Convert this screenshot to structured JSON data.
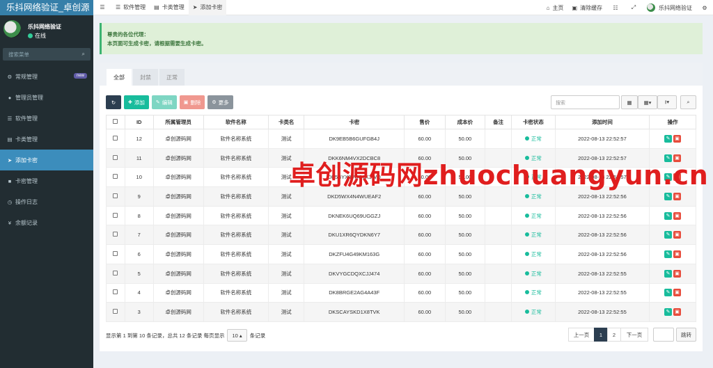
{
  "app": {
    "brand": "乐抖网络验证_卓创源"
  },
  "user": {
    "name": "乐抖网络验证",
    "status": "在线"
  },
  "sidebar": {
    "search_placeholder": "搜索菜单",
    "items": [
      {
        "label": "常规管理",
        "icon": "cogs-icon",
        "badge": "new"
      },
      {
        "label": "管理员管理",
        "icon": "user-icon"
      },
      {
        "label": "软件管理",
        "icon": "list-icon"
      },
      {
        "label": "卡类管理",
        "icon": "list-alt-icon"
      },
      {
        "label": "添加卡密",
        "icon": "send-icon",
        "active": true
      },
      {
        "label": "卡密管理",
        "icon": "file-icon"
      },
      {
        "label": "操作日志",
        "icon": "clock-icon"
      },
      {
        "label": "余额记录",
        "icon": "yen-icon"
      }
    ]
  },
  "topbar": {
    "tabs": [
      {
        "label": "软件管理"
      },
      {
        "label": "卡类管理"
      },
      {
        "label": "添加卡密",
        "active": true
      }
    ],
    "home": "主页",
    "clear_cache": "清除缓存",
    "user": "乐抖网络验证"
  },
  "notice": {
    "line1": "尊贵的各位代理：",
    "line2": "本页面可生成卡密，请根据需要生成卡密。"
  },
  "filter_tabs": [
    "全部",
    "封禁",
    "正常"
  ],
  "toolbar": {
    "add": "添加",
    "edit": "编辑",
    "delete": "删除",
    "more": "更多",
    "search_placeholder": "搜索"
  },
  "table": {
    "headers": [
      "ID",
      "所属管理员",
      "软件名称",
      "卡类名",
      "卡密",
      "售价",
      "成本价",
      "备注",
      "卡密状态",
      "添加时间",
      "操作"
    ],
    "rows": [
      {
        "id": "12",
        "admin": "卓创源码网",
        "software": "软件名称系统",
        "cardtype": "测试",
        "card": "DK9EB5B6GUFGB4J",
        "price": "60.00",
        "cost": "50.00",
        "remark": "",
        "status": "正常",
        "time": "2022-08-13 22:52:57"
      },
      {
        "id": "11",
        "admin": "卓创源码网",
        "software": "软件名称系统",
        "cardtype": "测试",
        "card": "DKK6NM4VX2DCBC8",
        "price": "60.00",
        "cost": "50.00",
        "remark": "",
        "status": "正常",
        "time": "2022-08-13 22:52:57"
      },
      {
        "id": "10",
        "admin": "卓创源码网",
        "software": "软件名称系统",
        "cardtype": "测试",
        "card": "DK5BYX8VUQ6K3WQ",
        "price": "60.00",
        "cost": "50.00",
        "remark": "",
        "status": "正常",
        "time": "2022-08-13 22:52:57"
      },
      {
        "id": "9",
        "admin": "卓创源码网",
        "software": "软件名称系统",
        "cardtype": "测试",
        "card": "DKD5WX4N4WUEAF2",
        "price": "60.00",
        "cost": "50.00",
        "remark": "",
        "status": "正常",
        "time": "2022-08-13 22:52:56"
      },
      {
        "id": "8",
        "admin": "卓创源码网",
        "software": "软件名称系统",
        "cardtype": "测试",
        "card": "DKNEK6UQ69UGGZJ",
        "price": "60.00",
        "cost": "50.00",
        "remark": "",
        "status": "正常",
        "time": "2022-08-13 22:52:56"
      },
      {
        "id": "7",
        "admin": "卓创源码网",
        "software": "软件名称系统",
        "cardtype": "测试",
        "card": "DKU1XR6QYDKN6Y7",
        "price": "60.00",
        "cost": "50.00",
        "remark": "",
        "status": "正常",
        "time": "2022-08-13 22:52:56"
      },
      {
        "id": "6",
        "admin": "卓创源码网",
        "software": "软件名称系统",
        "cardtype": "测试",
        "card": "DKZFU4G49KM163G",
        "price": "60.00",
        "cost": "50.00",
        "remark": "",
        "status": "正常",
        "time": "2022-08-13 22:52:56"
      },
      {
        "id": "5",
        "admin": "卓创源码网",
        "software": "软件名称系统",
        "cardtype": "测试",
        "card": "DKVYGCDQXCJJ474",
        "price": "60.00",
        "cost": "50.00",
        "remark": "",
        "status": "正常",
        "time": "2022-08-13 22:52:55"
      },
      {
        "id": "4",
        "admin": "卓创源码网",
        "software": "软件名称系统",
        "cardtype": "测试",
        "card": "DK8BRGE2AG4A43F",
        "price": "60.00",
        "cost": "50.00",
        "remark": "",
        "status": "正常",
        "time": "2022-08-13 22:52:55"
      },
      {
        "id": "3",
        "admin": "卓创源码网",
        "software": "软件名称系统",
        "cardtype": "测试",
        "card": "DKSCAYSKD1X8TVK",
        "price": "60.00",
        "cost": "50.00",
        "remark": "",
        "status": "正常",
        "time": "2022-08-13 22:52:55"
      }
    ]
  },
  "pagination": {
    "info_before": "显示第 1 到第 10 条记录，总共 12 条记录 每页显示",
    "page_size": "10",
    "info_after": "条记录",
    "prev": "上一页",
    "pages": [
      "1",
      "2"
    ],
    "current": "1",
    "next": "下一页",
    "goto": "跳转"
  },
  "watermark": "卓创源码网zhuochuangyun.cn",
  "colors": {
    "sidebar_bg": "#222d32",
    "active": "#3c8dbc",
    "success": "#18bc9c",
    "danger": "#e74c3c",
    "watermark": "#e01e1e"
  }
}
